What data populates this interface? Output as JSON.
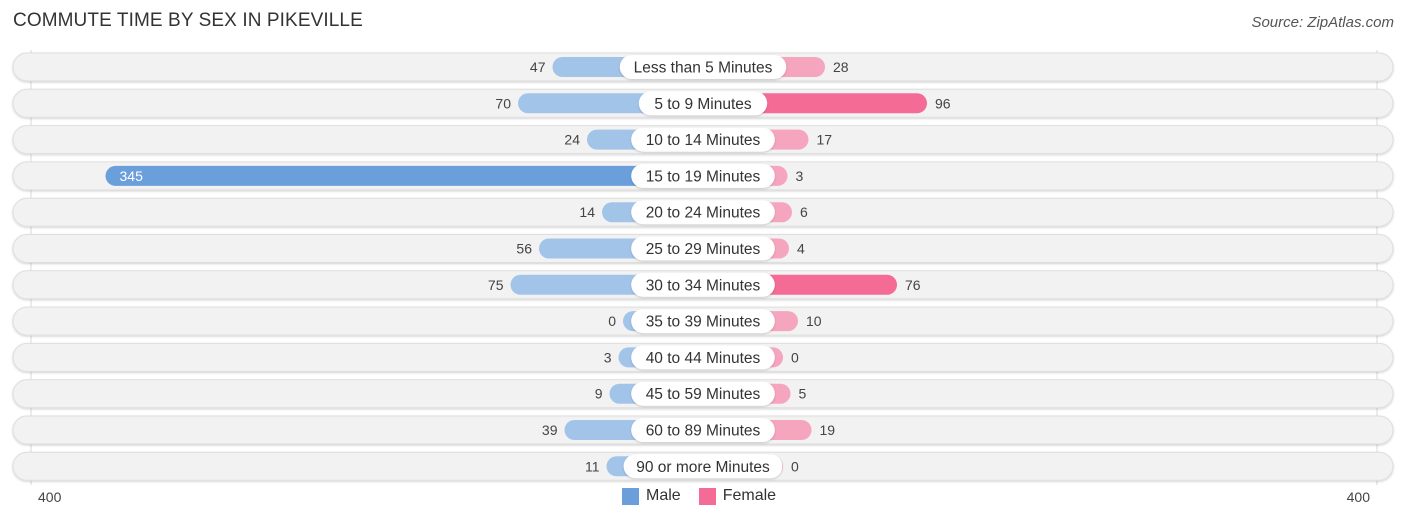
{
  "title": "COMMUTE TIME BY SEX IN PIKEVILLE",
  "source": "Source: ZipAtlas.com",
  "colors": {
    "male": "#6a9fdc",
    "male_light": "#a3c4e9",
    "female": "#f46b96",
    "female_light": "#f6a5bf",
    "track": "#f2f2f2"
  },
  "chart_data": {
    "type": "bar",
    "orientation": "horizontal-diverging",
    "title": "COMMUTE TIME BY SEX IN PIKEVILLE",
    "categories": [
      "Less than 5 Minutes",
      "5 to 9 Minutes",
      "10 to 14 Minutes",
      "15 to 19 Minutes",
      "20 to 24 Minutes",
      "25 to 29 Minutes",
      "30 to 34 Minutes",
      "35 to 39 Minutes",
      "40 to 44 Minutes",
      "45 to 59 Minutes",
      "60 to 89 Minutes",
      "90 or more Minutes"
    ],
    "series": [
      {
        "name": "Male",
        "values": [
          47,
          70,
          24,
          345,
          14,
          56,
          75,
          0,
          3,
          9,
          39,
          11
        ]
      },
      {
        "name": "Female",
        "values": [
          28,
          96,
          17,
          3,
          6,
          4,
          76,
          10,
          0,
          5,
          19,
          0
        ]
      }
    ],
    "xlim": [
      -400,
      400
    ],
    "axis_tick_labels": {
      "left": "400",
      "right": "400"
    },
    "legend": {
      "position": "bottom-center",
      "entries": [
        "Male",
        "Female"
      ]
    },
    "grid": false
  }
}
